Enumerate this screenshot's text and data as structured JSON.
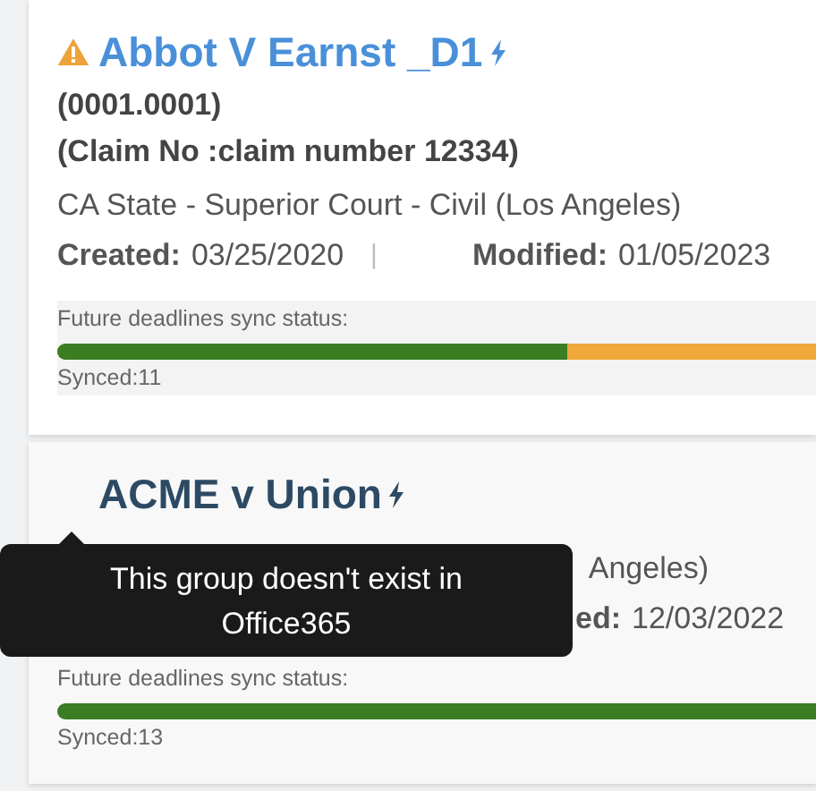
{
  "cases": [
    {
      "title": "Abbot V Earnst _D1",
      "warning": true,
      "number": "(0001.0001)",
      "claim": "(Claim No :claim number 12334)",
      "court": "CA State - Superior Court - Civil (Los Angeles)",
      "created_label": "Created:",
      "created": "03/25/2020",
      "separator": "|",
      "modified_label": "Modified:",
      "modified": "01/05/2023",
      "sync_label": "Future deadlines sync status:",
      "level": 0.672,
      "synced": "Synced:11"
    },
    {
      "title": "ACME v Union",
      "warning": false,
      "court": "Angeles)",
      "modified_label": "ed:",
      "modified": "12/03/2022",
      "sync_label": "Future deadlines sync status:",
      "level": 1,
      "synced": "Synced:13"
    }
  ],
  "tooltip": {
    "text": "This group doesn't exist in Office365"
  }
}
